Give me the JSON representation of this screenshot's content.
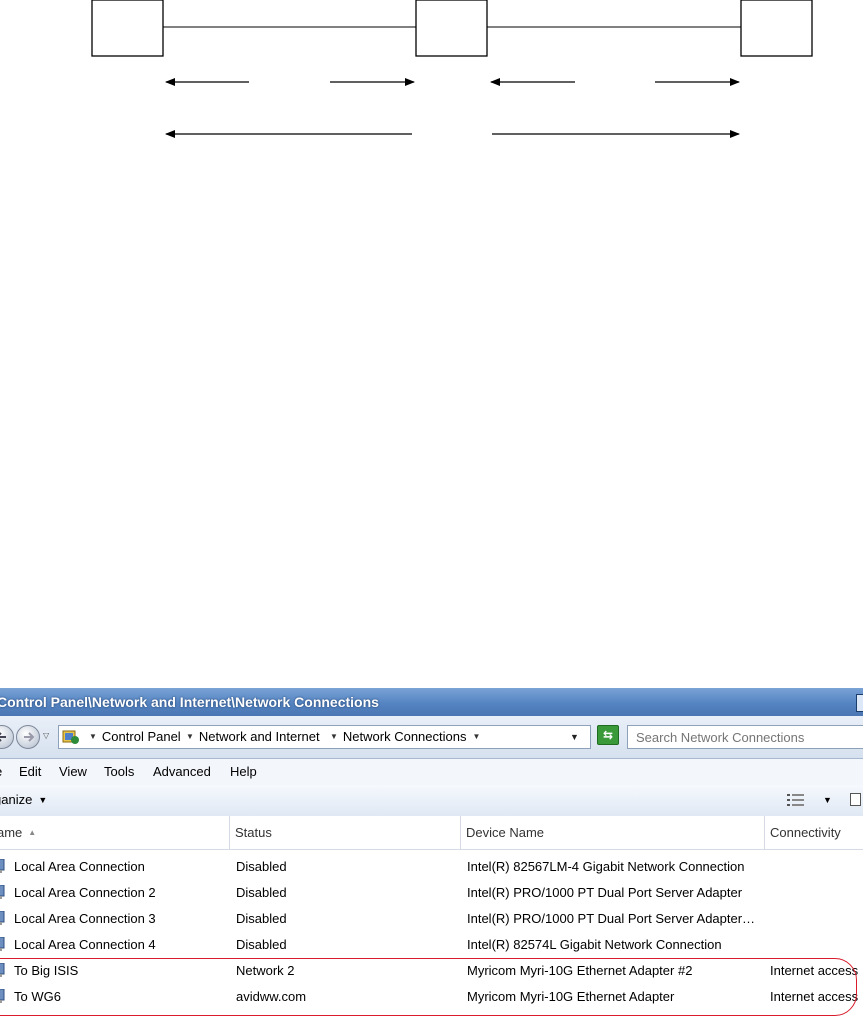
{
  "window": {
    "title": "Control Panel\\Network and Internet\\Network Connections"
  },
  "address_bar": {
    "crumbs": [
      "Control Panel",
      "Network and Internet",
      "Network Connections"
    ],
    "search_placeholder": "Search Network Connections"
  },
  "menu": [
    "Edit",
    "View",
    "Tools",
    "Advanced",
    "Help"
  ],
  "command_bar": {
    "organize_label": "ganize"
  },
  "columns": [
    "ame",
    "Status",
    "Device Name",
    "Connectivity"
  ],
  "connections": [
    {
      "name": "Local Area Connection",
      "status": "Disabled",
      "device": "Intel(R) 82567LM-4 Gigabit Network Connection",
      "connectivity": ""
    },
    {
      "name": "Local Area Connection 2",
      "status": "Disabled",
      "device": "Intel(R) PRO/1000 PT Dual Port Server Adapter",
      "connectivity": ""
    },
    {
      "name": "Local Area Connection 3",
      "status": "Disabled",
      "device": "Intel(R) PRO/1000 PT Dual Port Server Adapter…",
      "connectivity": ""
    },
    {
      "name": "Local Area Connection 4",
      "status": "Disabled",
      "device": "Intel(R) 82574L Gigabit Network Connection",
      "connectivity": ""
    },
    {
      "name": "To Big ISIS",
      "status": "Network  2",
      "device": "Myricom Myri-10G Ethernet Adapter #2",
      "connectivity": "Internet access"
    },
    {
      "name": "To WG6",
      "status": "avidww.com",
      "device": "Myricom Myri-10G Ethernet Adapter",
      "connectivity": "Internet access"
    }
  ],
  "colors": {
    "title_bar": "#5584c2",
    "highlight_outline": "#d81c2c",
    "refresh_button": "#3a9a3a"
  },
  "icons": {
    "back": "back-arrow-icon",
    "forward": "forward-arrow-icon",
    "control_panel": "control-panel-icon",
    "refresh": "refresh-icon",
    "views": "views-icon",
    "preview_pane": "preview-pane-icon",
    "connection": "network-adapter-icon"
  }
}
